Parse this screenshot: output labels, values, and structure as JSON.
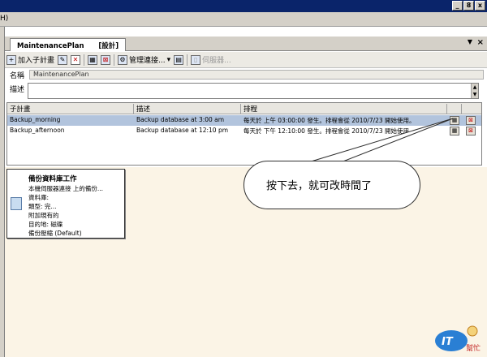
{
  "window": {
    "restore_label": "_",
    "max_label": "8",
    "close_label": "x",
    "menu_fragment": "H)"
  },
  "tab": {
    "title": "MaintenancePlan",
    "mode": "[設計]",
    "pin": "▼",
    "close": "×"
  },
  "toolbar": {
    "add_subplan": "加入子計畫",
    "manage_connections": "管理連接...",
    "server": "伺服器..."
  },
  "form": {
    "name_label": "名稱",
    "name_value": "MaintenancePlan",
    "desc_label": "描述"
  },
  "grid": {
    "headers": [
      "子計畫",
      "描述",
      "排程"
    ],
    "rows": [
      {
        "subplan": "Backup_morning",
        "desc": "Backup database at 3:00 am",
        "schedule": "每天於 上午 03:00:00 發生。排程會從 2010/7/23 開始使用。"
      },
      {
        "subplan": "Backup_afternoon",
        "desc": "Backup database at 12:10 pm",
        "schedule": "每天於 下午 12:10:00 發生。排程會從 2010/7/23 開始使用。"
      }
    ]
  },
  "task": {
    "title": "備份資料庫工作",
    "lines": [
      "本機伺服器連接 上的備份...",
      "資料庫:",
      "類型: 完...",
      "附加現有的",
      "目的地: 磁碟",
      "備份壓縮 (Default)"
    ]
  },
  "callout": {
    "text": "按下去，就可改時間了"
  },
  "logo": {
    "brand": "IT",
    "sub": "幫忙"
  },
  "colors": {
    "selected_row": "#b2c4dd",
    "designer_bg": "#fbf4e6",
    "title_bar": "#0a246a"
  }
}
